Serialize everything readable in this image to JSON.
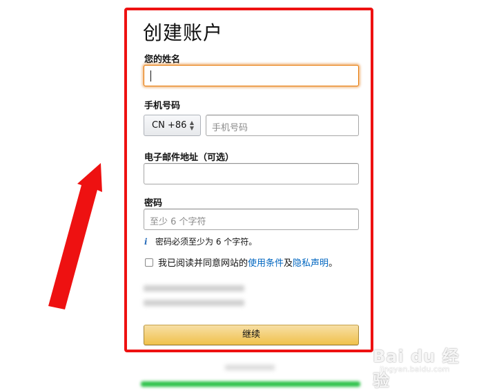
{
  "form": {
    "title": "创建账户",
    "name_label": "您的姓名",
    "name_value": "",
    "phone_label": "手机号码",
    "country_code": "CN +86",
    "phone_placeholder": "手机号码",
    "email_label": "电子邮件地址（可选）",
    "email_value": "",
    "password_label": "密码",
    "password_placeholder": "至少 6 个字符",
    "password_hint": "密码必须至少为 6 个字符。",
    "agree_text_prefix": "我已阅读并同意网站的",
    "terms_link": "使用条件",
    "agree_and": "及",
    "privacy_link": "隐私声明",
    "agree_suffix": "。",
    "continue_label": "继续"
  },
  "watermark": {
    "main": "Bai du 经验",
    "sub": "jingyan.baidu.com"
  },
  "colors": {
    "highlight_border": "#ee1111",
    "focus": "#e77600",
    "link": "#0066c0",
    "button": "#f0c14b"
  }
}
